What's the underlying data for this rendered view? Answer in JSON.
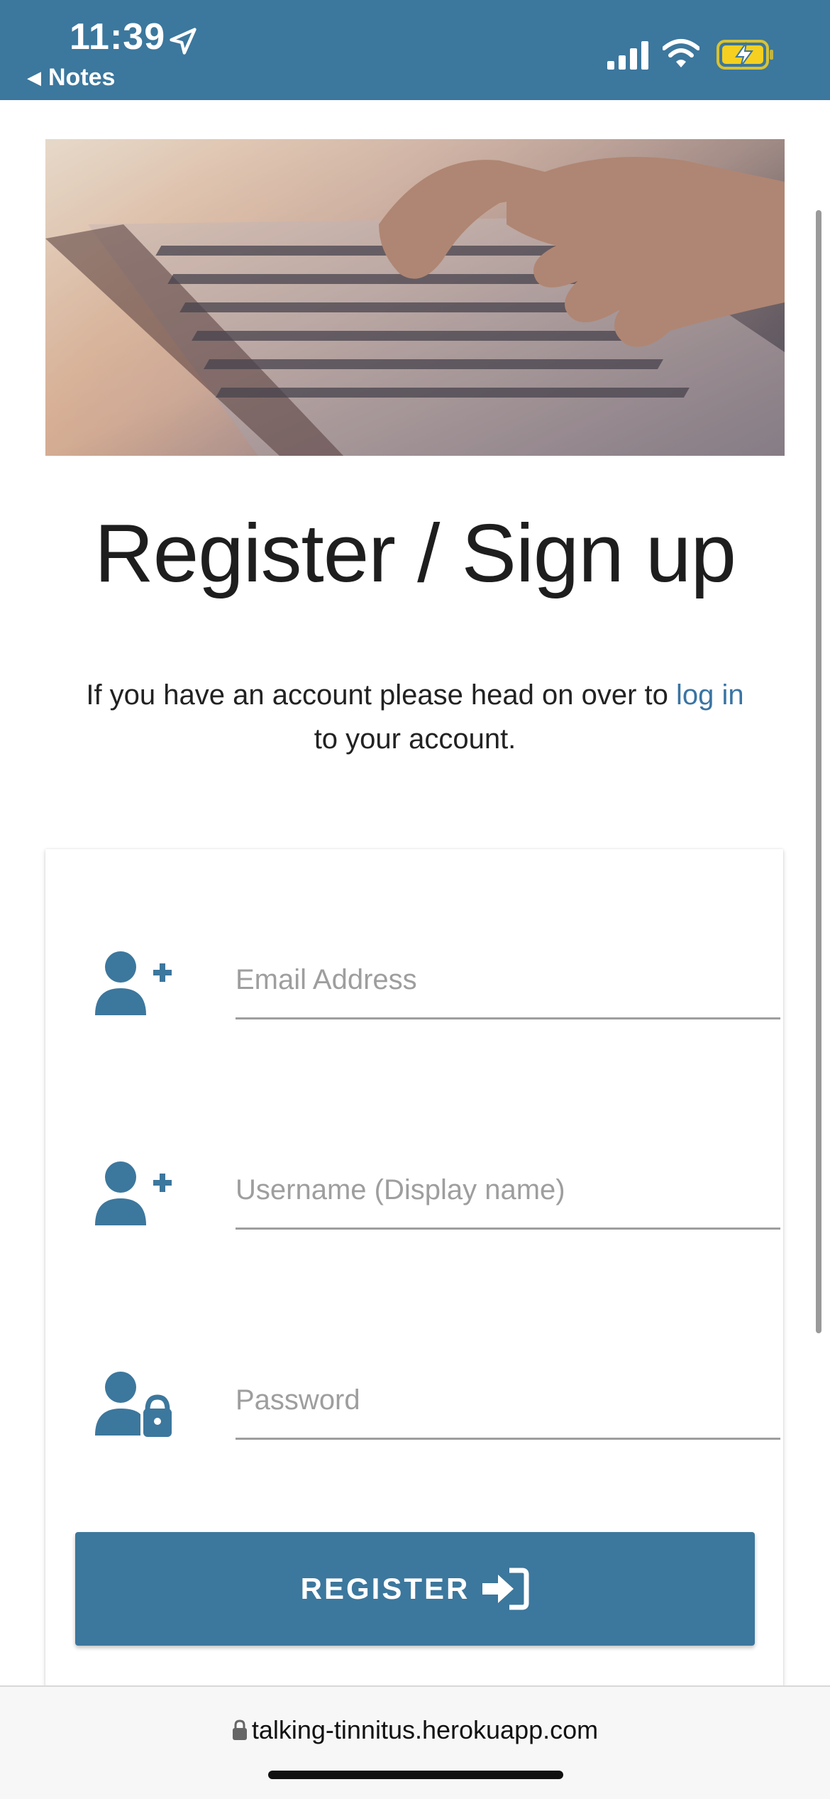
{
  "status_bar": {
    "time": "11:39",
    "back_app": "Notes",
    "icons": [
      "location-arrow-icon",
      "signal-icon",
      "wifi-icon",
      "battery-charging-icon"
    ]
  },
  "page": {
    "title": "Register / Sign up",
    "intro_before": "If you have an account please head on over to ",
    "intro_link": "log in",
    "intro_after": " to your account."
  },
  "form": {
    "email_placeholder": "Email Address",
    "username_placeholder": "Username (Display name)",
    "password_placeholder": "Password",
    "register_label": "REGISTER"
  },
  "browser": {
    "url": "talking-tinnitus.herokuapp.com"
  },
  "colors": {
    "brand": "#3c779d",
    "link": "#3a74a3",
    "battery": "#f5d020"
  }
}
